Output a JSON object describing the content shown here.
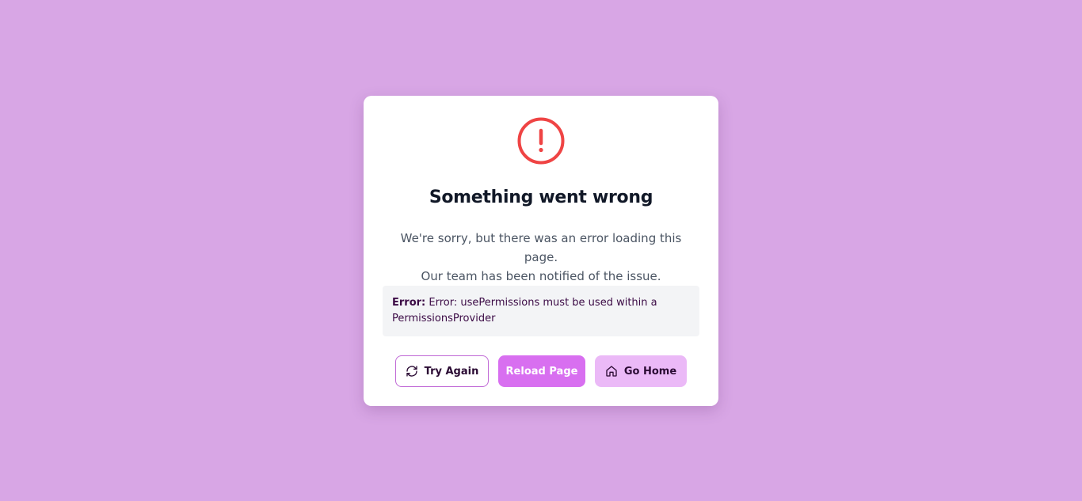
{
  "error_card": {
    "icon": "alert-circle-icon",
    "icon_color": "#ef4444",
    "title": "Something went wrong",
    "message_line1": "We're sorry, but there was an error loading this page.",
    "message_line2": "Our team has been notified of the issue.",
    "error_label": "Error:",
    "error_text": "Error: usePermissions must be used within a PermissionsProvider"
  },
  "actions": {
    "try_again": {
      "label": "Try Again",
      "icon": "refresh-icon"
    },
    "reload": {
      "label": "Reload Page"
    },
    "go_home": {
      "label": "Go Home",
      "icon": "home-icon"
    }
  },
  "colors": {
    "background": "#d8a6e5",
    "primary": "#d86ff0",
    "secondary": "#ebb9f7",
    "error": "#ef4444"
  }
}
